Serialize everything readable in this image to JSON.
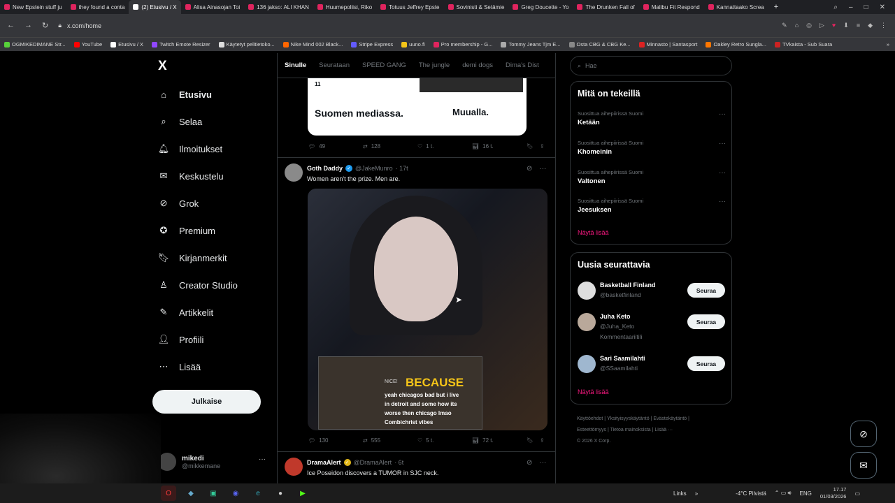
{
  "browser": {
    "tabs": [
      {
        "label": "New Epstein stuff ju",
        "active": false
      },
      {
        "label": "they found a conta",
        "active": false
      },
      {
        "label": "(2) Etusivu / X",
        "active": true
      },
      {
        "label": "Alisa Ainasojan Toi",
        "active": false
      },
      {
        "label": "136 jakso: ALI KHAN",
        "active": false
      },
      {
        "label": "Huumepoliisi, Riko",
        "active": false
      },
      {
        "label": "Totuus Jeffrey Epste",
        "active": false
      },
      {
        "label": "Sovinisti & Setämie",
        "active": false
      },
      {
        "label": "Greg Doucette - Yo",
        "active": false
      },
      {
        "label": "The Drunken Fall of",
        "active": false
      },
      {
        "label": "Malibu Fit Respond",
        "active": false
      },
      {
        "label": "Kannattaako Screa",
        "active": false
      }
    ],
    "url": "x.com/home",
    "bookmarks": [
      "OGMIKEDIMANE Str...",
      "YouTube",
      "Etusivu / X",
      "Twitch Emote Resizer",
      "Käytetyt pelitietoko...",
      "Nike Mind 002 Black...",
      "Stripe Express",
      "uuno.fi",
      "Pro membership - G...",
      "Tommy Jeans Tjm E...",
      "Osta CBG & CBG Ke...",
      "Minnasto | Santasport",
      "Oakley Retro Sungla...",
      "TVkaista - Sub Suara"
    ]
  },
  "sidebar": {
    "logo": "X",
    "items": [
      {
        "label": "Etusivu",
        "icon": "home-icon"
      },
      {
        "label": "Selaa",
        "icon": "search-icon"
      },
      {
        "label": "Ilmoitukset",
        "icon": "bell-icon"
      },
      {
        "label": "Keskustelu",
        "icon": "mail-icon"
      },
      {
        "label": "Grok",
        "icon": "grok-icon"
      },
      {
        "label": "Premium",
        "icon": "premium-icon"
      },
      {
        "label": "Kirjanmerkit",
        "icon": "bookmark-icon"
      },
      {
        "label": "Creator Studio",
        "icon": "creator-icon"
      },
      {
        "label": "Artikkelit",
        "icon": "articles-icon"
      },
      {
        "label": "Profiili",
        "icon": "profile-icon"
      },
      {
        "label": "Lisää",
        "icon": "more-icon"
      }
    ],
    "post_button": "Julkaise",
    "account": {
      "name": "mikedi",
      "handle": "@mikkemane"
    }
  },
  "feed": {
    "tabs": [
      "Sinulle",
      "Seurataan",
      "SPEED GANG",
      "The jungle",
      "demi dogs",
      "Dima's Dist"
    ],
    "card": {
      "top_text": "11",
      "left": "Suomen mediassa.",
      "right": "Muualla."
    },
    "post0_actions": {
      "replies": "49",
      "reposts": "128",
      "likes": "1 t.",
      "views": "16 t."
    },
    "post1": {
      "name": "Goth Daddy",
      "handle": "@JakeMunro",
      "time": "· 17t",
      "text": "Women aren't the prize. Men are.",
      "media": {
        "nice": "NICE!",
        "big_word": "BECAUSE",
        "caption": "yeah chicagos bad but i live\nin detroit and some how its\nworse then chicago lmao\nCombichrist vibes"
      },
      "actions": {
        "replies": "130",
        "reposts": "555",
        "likes": "5 t.",
        "views": "72 t."
      }
    },
    "post2": {
      "name": "DramaAlert",
      "handle": "@DramaAlert",
      "time": "· 6t",
      "text": "Ice Poseidon discovers a TUMOR in SJC neck."
    }
  },
  "right": {
    "search_placeholder": "Hae",
    "trends_title": "Mitä on tekeillä",
    "trends": [
      {
        "context": "Suosittua aihepiirissä Suomi",
        "topic": "Ketään"
      },
      {
        "context": "Suosittua aihepiirissä Suomi",
        "topic": "Khomeinin"
      },
      {
        "context": "Suosittua aihepiirissä Suomi",
        "topic": "Valtonen"
      },
      {
        "context": "Suosittua aihepiirissä Suomi",
        "topic": "Jeesuksen"
      }
    ],
    "show_more": "Näytä lisää",
    "who_title": "Uusia seurattavia",
    "who": [
      {
        "name": "Basketball Finland",
        "handle": "@basketfinland",
        "bio": "",
        "button": "Seuraa"
      },
      {
        "name": "Juha Keto",
        "handle": "@Juha_Keto",
        "bio": "Kommentaariitili",
        "button": "Seuraa"
      },
      {
        "name": "Sari Saamilahti",
        "handle": "@SSaamilahti",
        "bio": "",
        "button": "Seuraa"
      }
    ],
    "who_more": "Näytä lisää",
    "footer_line1": "Käyttöehdot | Yksityisyyskäytäntö | Evästekäytäntö |",
    "footer_line2": "Esteettömyys | Tietoa mainoksista | Lisää ···",
    "footer_line3": "© 2026 X Corp."
  },
  "taskbar": {
    "links": "Links",
    "weather": "-4°C Pilvistä",
    "lang": "ENG",
    "time": "17.17",
    "date": "01/03/2026"
  }
}
